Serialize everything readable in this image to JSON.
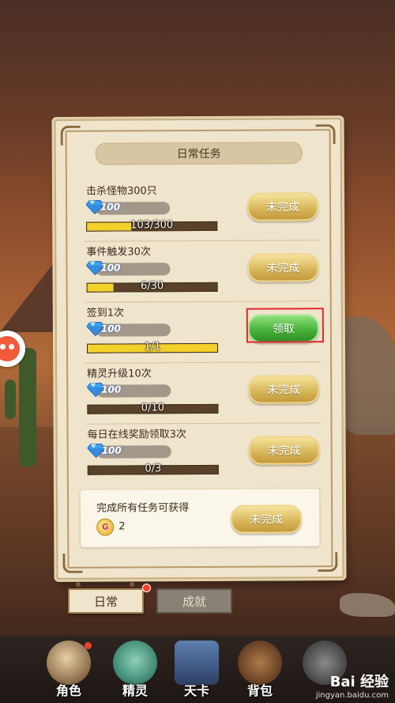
{
  "panel": {
    "title": "日常任务"
  },
  "tasks": [
    {
      "name": "击杀怪物300只",
      "reward": "100",
      "progress_text": "103/300",
      "progress": 0.343,
      "button": "未完成",
      "status": "incomplete"
    },
    {
      "name": "事件触发30次",
      "reward": "100",
      "progress_text": "6/30",
      "progress": 0.2,
      "button": "未完成",
      "status": "incomplete"
    },
    {
      "name": "签到1次",
      "reward": "100",
      "progress_text": "1/1",
      "progress": 1.0,
      "button": "领取",
      "status": "claimable"
    },
    {
      "name": "精灵升级10次",
      "reward": "100",
      "progress_text": "0/10",
      "progress": 0,
      "button": "未完成",
      "status": "incomplete"
    },
    {
      "name": "每日在线奖励领取3次",
      "reward": "100",
      "progress_text": "0/3",
      "progress": 0,
      "button": "未完成",
      "status": "incomplete"
    }
  ],
  "summary": {
    "title": "完成所有任务可获得",
    "reward_count": "2",
    "button": "未完成"
  },
  "tabs": [
    {
      "label": "日常",
      "active": true
    },
    {
      "label": "成就",
      "active": false
    }
  ],
  "bottom_nav": [
    {
      "label": "角色"
    },
    {
      "label": "精灵"
    },
    {
      "label": "天卡"
    },
    {
      "label": "背包"
    },
    {
      "label": ""
    }
  ],
  "watermark": {
    "logo": "Bai 经验",
    "url": "jingyan.baidu.com"
  },
  "colors": {
    "progress_fill": "#f3d12a",
    "button_incomplete": "#d9b85c",
    "button_claim": "#49b23a",
    "highlight": "#e0282a"
  }
}
